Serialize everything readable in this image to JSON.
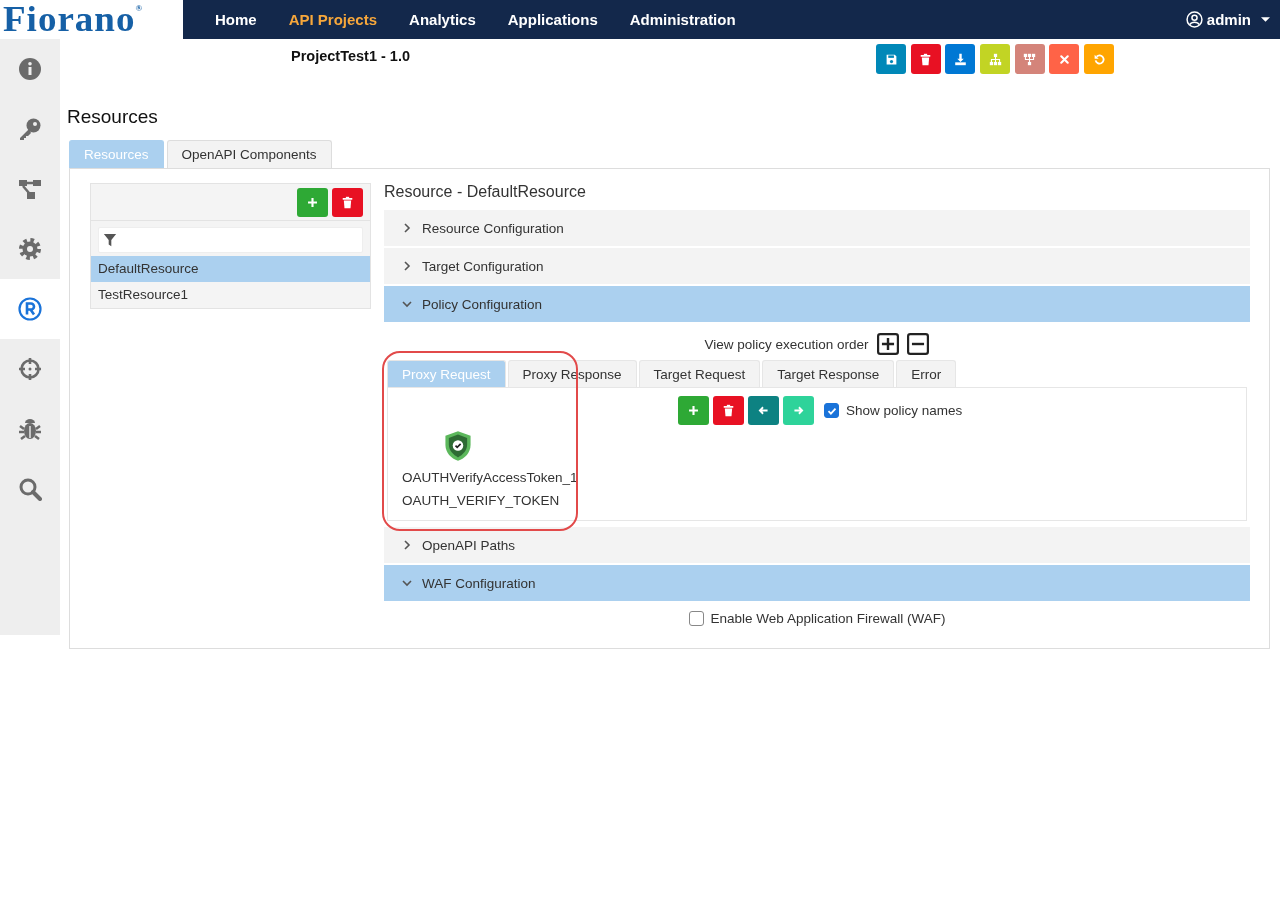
{
  "brand": {
    "logo": "Fiorano$^{®}$"
  },
  "nav": {
    "items": [
      {
        "label": "Home",
        "selected": false
      },
      {
        "label": "API Projects",
        "selected": true
      },
      {
        "label": "Analytics",
        "selected": false
      },
      {
        "label": "Applications",
        "selected": false
      },
      {
        "label": "Administration",
        "selected": false
      }
    ],
    "user": {
      "label": "admin"
    }
  },
  "sidebar": {
    "items": [
      {
        "kind": "info",
        "selected": false
      },
      {
        "kind": "key",
        "selected": false
      },
      {
        "kind": "flow",
        "selected": false
      },
      {
        "kind": "gear",
        "selected": false
      },
      {
        "kind": "registered",
        "selected": true
      },
      {
        "kind": "crosshair",
        "selected": false
      },
      {
        "kind": "bug",
        "selected": false
      },
      {
        "kind": "search",
        "selected": false
      }
    ]
  },
  "project": {
    "title": "ProjectTest1 - 1.0",
    "toolbar": [
      {
        "kind": "save",
        "color": "#0088b8"
      },
      {
        "kind": "delete",
        "color": "#e81123"
      },
      {
        "kind": "download",
        "color": "#0078d4"
      },
      {
        "kind": "hierarchy",
        "color": "#c2d424"
      },
      {
        "kind": "tree",
        "color": "#d4847a"
      },
      {
        "kind": "close",
        "color": "#ff6347"
      },
      {
        "kind": "undo",
        "color": "#ffa500"
      }
    ]
  },
  "page_title": "Resources",
  "tabs": [
    {
      "label": "Resources",
      "selected": true
    },
    {
      "label": "OpenAPI Components",
      "selected": false
    }
  ],
  "resource_list": {
    "buttons": [
      {
        "kind": "add"
      },
      {
        "kind": "delete"
      }
    ],
    "items": [
      {
        "label": "DefaultResource",
        "selected": true
      },
      {
        "label": "TestResource1",
        "selected": false
      }
    ]
  },
  "detail": {
    "title": "Resource - DefaultResource",
    "sections": [
      {
        "title": "Resource Configuration",
        "expanded": false
      },
      {
        "title": "Target Configuration",
        "expanded": false
      },
      {
        "kind": "policy",
        "title": "Policy Configuration",
        "expanded": true,
        "order_label": "View policy execution order",
        "highlighted": true,
        "tabs": [
          {
            "label": "Proxy Request",
            "selected": true
          },
          {
            "label": "Proxy Response",
            "selected": false
          },
          {
            "label": "Target Request",
            "selected": false
          },
          {
            "label": "Target Response",
            "selected": false
          },
          {
            "label": "Error",
            "selected": false
          }
        ],
        "buttons": [
          {
            "kind": "add"
          },
          {
            "kind": "delete"
          },
          {
            "kind": "left"
          },
          {
            "kind": "right"
          }
        ],
        "show_names": {
          "label": "Show policy names",
          "checked": true
        },
        "policies": [
          {
            "name": "OAUTHVerifyAccessToken_1",
            "type": "OAUTH_VERIFY_TOKEN"
          }
        ]
      },
      {
        "title": "OpenAPI Paths",
        "expanded": false
      },
      {
        "kind": "waf",
        "title": "WAF Configuration",
        "expanded": true,
        "checkbox": {
          "label": "Enable Web Application Firewall (WAF)",
          "checked": false
        }
      }
    ]
  }
}
